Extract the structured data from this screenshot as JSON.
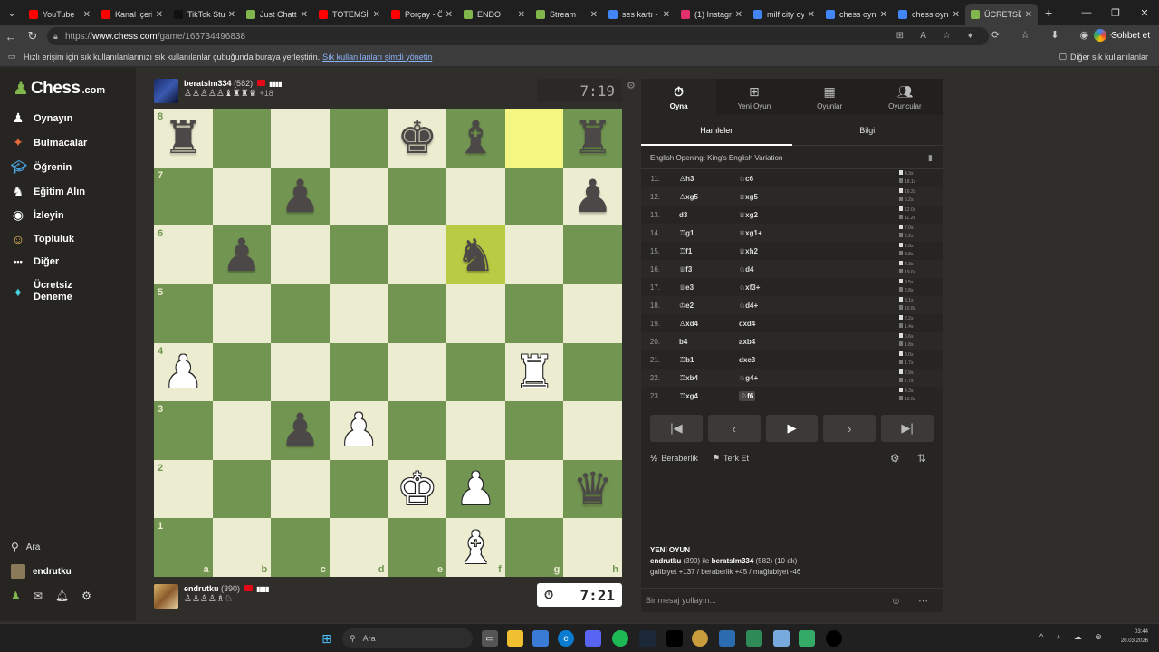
{
  "browser": {
    "tabs": [
      {
        "title": "YouTube",
        "color": "#ff0000",
        "active": false
      },
      {
        "title": "Kanal içeriği",
        "color": "#ff0000",
        "active": false
      },
      {
        "title": "TikTok Studi",
        "color": "#111111",
        "active": false
      },
      {
        "title": "Just Chattin",
        "color": "#81b64c",
        "active": false
      },
      {
        "title": "TOTEMSİZ",
        "color": "#ff0000",
        "active": false
      },
      {
        "title": "Porçay - Ö",
        "color": "#ff0000",
        "active": false
      },
      {
        "title": "ENDO",
        "color": "#81b64c",
        "active": false
      },
      {
        "title": "Stream",
        "color": "#81b64c",
        "active": false
      },
      {
        "title": "ses kartı - C",
        "color": "#4285f4",
        "active": false
      },
      {
        "title": "(1) Instagra",
        "color": "#e1306c",
        "active": false
      },
      {
        "title": "milf city oy",
        "color": "#4285f4",
        "active": false
      },
      {
        "title": "chess oyna",
        "color": "#4285f4",
        "active": false
      },
      {
        "title": "chess oyna",
        "color": "#4285f4",
        "active": false
      },
      {
        "title": "ÜCRETSİZ C",
        "color": "#81b64c",
        "active": true
      }
    ],
    "url_prefix": "https://",
    "url_domain": "www.chess.com",
    "url_path": "/game/165734496838",
    "chat_button": "Sohbet et",
    "bookmark_text": "Hızlı erişim için sık kullanılanlarınızı sık kullanılanlar çubuğunda buraya yerleştirin.",
    "bookmark_link": "Sık kullanılanları şimdi yönetin",
    "other_favorites": "Diğer sık kullanılanlar"
  },
  "sidebar": {
    "logo": "Chess",
    "logo_suffix": ".com",
    "items": [
      {
        "label": "Oynayın",
        "icon": "play-icon"
      },
      {
        "label": "Bulmacalar",
        "icon": "puzzle-icon"
      },
      {
        "label": "Öğrenin",
        "icon": "learn-icon"
      },
      {
        "label": "Eğitim Alın",
        "icon": "train-icon"
      },
      {
        "label": "İzleyin",
        "icon": "watch-icon"
      },
      {
        "label": "Topluluk",
        "icon": "community-icon"
      },
      {
        "label": "Diğer",
        "icon": "more-icon"
      },
      {
        "label": "Ücretsiz Deneme",
        "icon": "diamond-icon"
      }
    ],
    "search": "Ara",
    "username": "endrutku"
  },
  "top_player": {
    "name": "beratslm334",
    "rating": "(582)",
    "captured": "♙♙♙♙♙♝♜♜♛",
    "diff": "+18",
    "clock": "7:19"
  },
  "bottom_player": {
    "name": "endrutku",
    "rating": "(390)",
    "captured": "♙♙♙♙♗♘",
    "clock": "7:21"
  },
  "board": {
    "ranks": [
      "8",
      "7",
      "6",
      "5",
      "4",
      "3",
      "2",
      "1"
    ],
    "files": [
      "a",
      "b",
      "c",
      "d",
      "e",
      "f",
      "g",
      "h"
    ],
    "position": [
      [
        "bR",
        "",
        "",
        "",
        "bK",
        "bB",
        "",
        "bR"
      ],
      [
        "",
        "",
        "bP",
        "",
        "",
        "",
        "",
        "bP"
      ],
      [
        "",
        "bP",
        "",
        "",
        "",
        "bN",
        "",
        ""
      ],
      [
        "",
        "",
        "",
        "",
        "",
        "",
        "",
        ""
      ],
      [
        "wP",
        "",
        "",
        "",
        "",
        "",
        "wR",
        ""
      ],
      [
        "",
        "",
        "bP",
        "wP",
        "",
        "",
        "",
        ""
      ],
      [
        "",
        "",
        "",
        "",
        "wK",
        "wP",
        "",
        "bQ"
      ],
      [
        "",
        "",
        "",
        "",
        "",
        "wB",
        "",
        ""
      ]
    ],
    "highlights": [
      "g8",
      "f6"
    ]
  },
  "panel": {
    "top_tabs": [
      {
        "label": "Oyna",
        "icon": "stopwatch-icon",
        "active": true
      },
      {
        "label": "Yeni Oyun",
        "icon": "plus-icon",
        "active": false
      },
      {
        "label": "Oyunlar",
        "icon": "board-icon",
        "active": false
      },
      {
        "label": "Oyuncular",
        "icon": "users-icon",
        "active": false
      }
    ],
    "sub_tabs": [
      {
        "label": "Hamleler",
        "active": true
      },
      {
        "label": "Bilgi",
        "active": false
      }
    ],
    "opening": "English Opening: King's English Variation",
    "moves": [
      {
        "n": "11.",
        "w": "♙h3",
        "b": "♘c6",
        "tw": "4.3s",
        "tb": "18.1s"
      },
      {
        "n": "12.",
        "w": "♙xg5",
        "b": "♕xg5",
        "tw": "16.2s",
        "tb": "5.2s"
      },
      {
        "n": "13.",
        "w": "d3",
        "b": "♕xg2",
        "tw": "12.0s",
        "tb": "11.2s"
      },
      {
        "n": "14.",
        "w": "♖g1",
        "b": "♕xg1+",
        "tw": "7.0s",
        "tb": "2.2s"
      },
      {
        "n": "15.",
        "w": "♖f1",
        "b": "♕xh2",
        "tw": "2.8s",
        "tb": "8.8s"
      },
      {
        "n": "16.",
        "w": "♕f3",
        "b": "♘d4",
        "tw": "4.3s",
        "tb": "19.6s"
      },
      {
        "n": "17.",
        "w": "♕e3",
        "b": "♘xf3+",
        "tw": "9.5s",
        "tb": "2.8s"
      },
      {
        "n": "18.",
        "w": "♔e2",
        "b": "♘d4+",
        "tw": "3.1s",
        "tb": "10.8s"
      },
      {
        "n": "19.",
        "w": "♙xd4",
        "b": "cxd4",
        "tw": "2.2s",
        "tb": "1.4s"
      },
      {
        "n": "20.",
        "w": "b4",
        "b": "axb4",
        "tw": "6.6s",
        "tb": "1.8s"
      },
      {
        "n": "21.",
        "w": "♖b1",
        "b": "dxc3",
        "tw": "3.0s",
        "tb": "1.7s"
      },
      {
        "n": "22.",
        "w": "♖xb4",
        "b": "♘g4+",
        "tw": "2.9s",
        "tb": "7.7s"
      },
      {
        "n": "23.",
        "w": "♖xg4",
        "b": "♘f6",
        "tw": "4.3s",
        "tb": "13.6s"
      }
    ],
    "draw_label": "Beraberlik",
    "resign_label": "Terk Et",
    "new_game_header": "YENİ OYUN",
    "new_game_line1_p1": "endrutku",
    "new_game_line1_r1": " (390) ile ",
    "new_game_line1_p2": "beratslm334",
    "new_game_line1_rest": " (582) (10 dk)",
    "new_game_line2": "galibiyet +137 / beraberlik +45 / mağlubiyet -46",
    "chat_placeholder": "Bir mesaj yollayın..."
  },
  "taskbar": {
    "search": "Ara",
    "time": "03:44",
    "date": "20.03.2026"
  }
}
